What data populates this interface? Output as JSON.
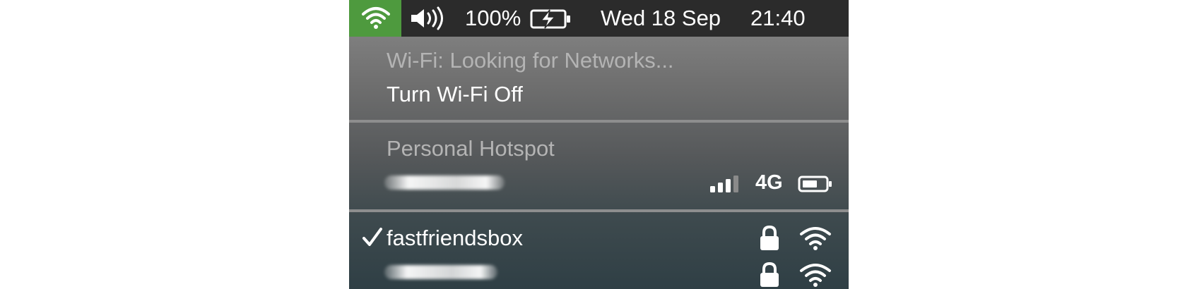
{
  "menubar": {
    "wifi_icon": "wifi-icon",
    "volume_icon": "volume-icon",
    "battery_percent": "100%",
    "battery_icon": "battery-charging-icon",
    "date": "Wed 18 Sep",
    "time": "21:40",
    "wifi_tile_color": "#4e9a3e"
  },
  "wifi_menu": {
    "status": "Wi-Fi: Looking for Networks...",
    "toggle_label": "Turn Wi-Fi Off",
    "hotspot_section_title": "Personal Hotspot",
    "hotspot": {
      "network_type": "4G",
      "signal_bars_filled": 3,
      "signal_bars_total": 4,
      "battery_icon": "battery-icon"
    },
    "networks": [
      {
        "name": "fastfriendsbox",
        "selected": true,
        "secured": true,
        "icons": [
          "checkmark-icon",
          "lock-icon",
          "wifi-icon"
        ]
      },
      {
        "name": "",
        "selected": false,
        "secured": true,
        "icons": [
          "lock-icon",
          "wifi-icon"
        ]
      }
    ]
  }
}
